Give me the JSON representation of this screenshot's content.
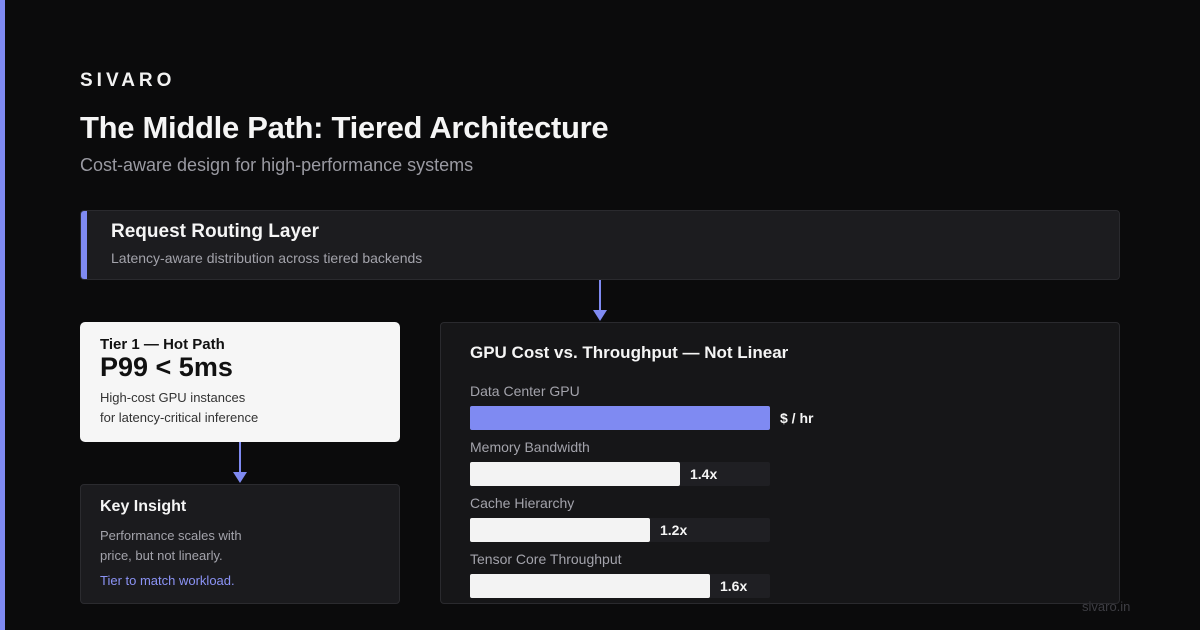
{
  "brand": "SIVARO",
  "title": "The Middle Path: Tiered Architecture",
  "subtitle": "Cost-aware design for high-performance systems",
  "routing": {
    "title": "Request Routing Layer",
    "description": "Latency-aware distribution across tiered backends"
  },
  "tier1": {
    "label": "Tier 1 — Hot Path",
    "metric": "P99 < 5ms",
    "description_line1": "High-cost GPU instances",
    "description_line2": "for latency-critical inference"
  },
  "insight": {
    "title": "Key Insight",
    "body_line1": "Performance scales with",
    "body_line2": "price, but not linearly.",
    "link": "Tier to match workload."
  },
  "chart_data": {
    "type": "bar",
    "orientation": "horizontal",
    "title": "GPU Cost vs. Throughput — Not Linear",
    "categories": [
      "Data Center GPU",
      "Memory Bandwidth",
      "Cache Hierarchy",
      "Tensor Core Throughput"
    ],
    "value_labels": [
      "$ / hr",
      "1.4x",
      "1.2x",
      "1.6x"
    ],
    "values": [
      1.0,
      0.7,
      0.6,
      0.8
    ],
    "colors": [
      "#7f8af2",
      "#f3f3f3",
      "#f3f3f3",
      "#f3f3f3"
    ]
  },
  "footer": "sivaro.in",
  "colors": {
    "accent": "#7f8af2",
    "background": "#0b0b0c",
    "card": "#1c1c1f"
  }
}
